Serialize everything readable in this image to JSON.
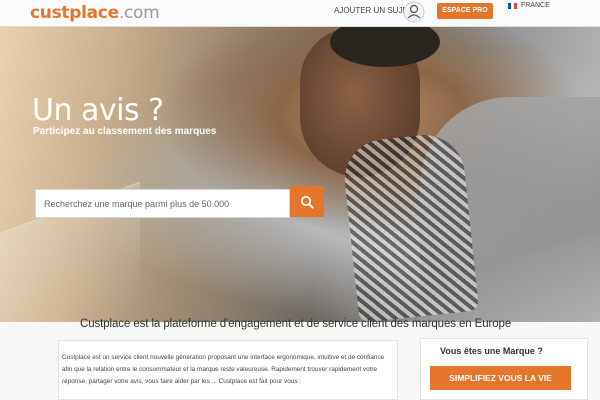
{
  "header": {
    "logo_main": "custplace",
    "logo_suffix": ".com",
    "nav_add_topic": "AJOUTER UN SUJET",
    "pro_button": "ESPACE PRO",
    "language": "FRANCE"
  },
  "hero": {
    "title": "Un avis ?",
    "subtitle": "Participez au classement des marques",
    "search_placeholder": "Recherchez une marque parmi plus de 50.000",
    "search_icon": "search-icon"
  },
  "info": {
    "heading": "Custplace est la plateforme d'engagement et de service client des marques en Europe",
    "body": "Custplace est un service client nouvelle génération proposant une interface ergonomique, intuitive et de confiance afin que la relation entre le consommateur et la marque reste valeureuse. Rapidement trouver rapidement votre réponse, partager votre avis, vous faire aider par les ... Custplace est fait pour vous :",
    "brand_question": "Vous êtes une Marque ?",
    "cta_label": "SIMPLIFIEZ VOUS LA VIE"
  },
  "colors": {
    "accent": "#e5752a",
    "logo_gray": "#9a9a9a"
  }
}
